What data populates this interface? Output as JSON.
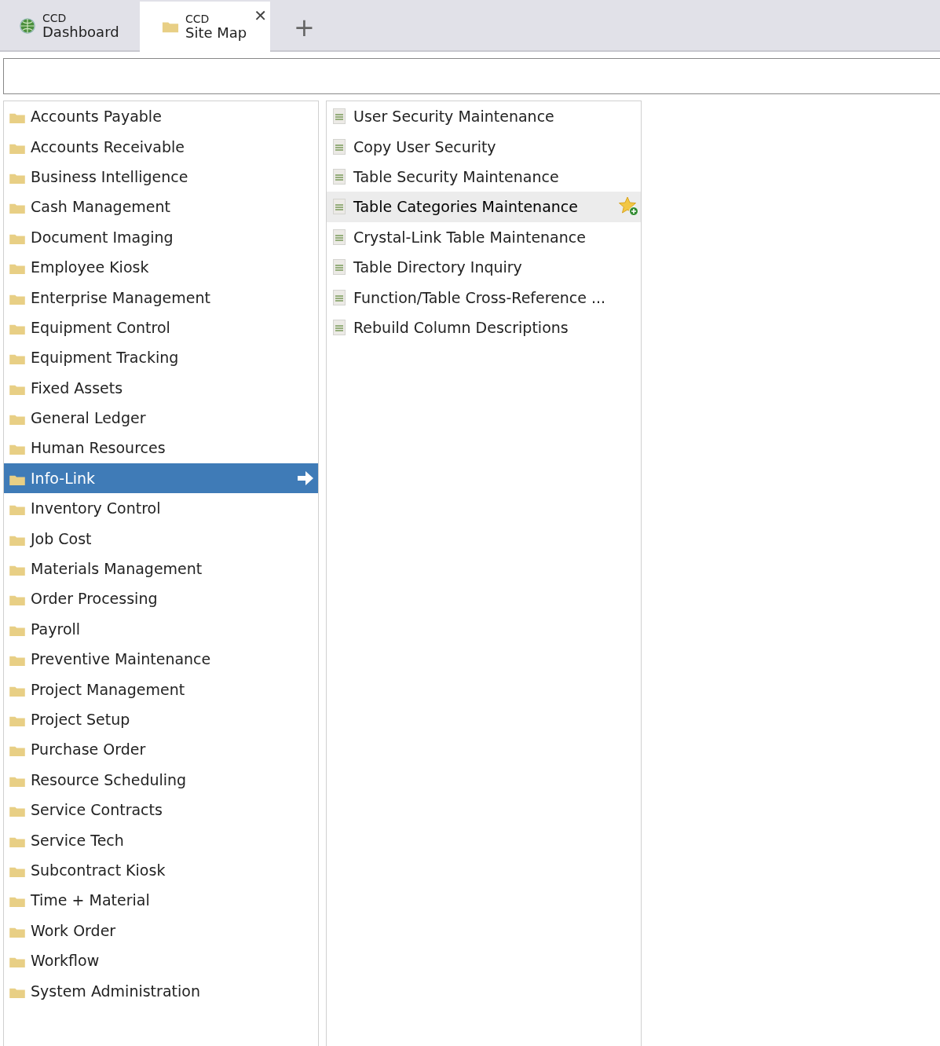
{
  "tabs": [
    {
      "kind": "globe",
      "line1": "CCD",
      "line2": "Dashboard",
      "selected": false,
      "closable": false
    },
    {
      "kind": "folder",
      "line1": "CCD",
      "line2": "Site Map",
      "selected": true,
      "closable": true
    }
  ],
  "new_tab": "+",
  "close_glyph": "✕",
  "modules": [
    {
      "label": "Accounts Payable",
      "selected": false
    },
    {
      "label": "Accounts Receivable",
      "selected": false
    },
    {
      "label": "Business Intelligence",
      "selected": false
    },
    {
      "label": "Cash Management",
      "selected": false
    },
    {
      "label": "Document Imaging",
      "selected": false
    },
    {
      "label": "Employee Kiosk",
      "selected": false
    },
    {
      "label": "Enterprise Management",
      "selected": false
    },
    {
      "label": "Equipment Control",
      "selected": false
    },
    {
      "label": "Equipment Tracking",
      "selected": false
    },
    {
      "label": "Fixed Assets",
      "selected": false
    },
    {
      "label": "General Ledger",
      "selected": false
    },
    {
      "label": "Human Resources",
      "selected": false
    },
    {
      "label": "Info-Link",
      "selected": true
    },
    {
      "label": "Inventory Control",
      "selected": false
    },
    {
      "label": "Job Cost",
      "selected": false
    },
    {
      "label": "Materials Management",
      "selected": false
    },
    {
      "label": "Order Processing",
      "selected": false
    },
    {
      "label": "Payroll",
      "selected": false
    },
    {
      "label": "Preventive Maintenance",
      "selected": false
    },
    {
      "label": "Project Management",
      "selected": false
    },
    {
      "label": "Project Setup",
      "selected": false
    },
    {
      "label": "Purchase Order",
      "selected": false
    },
    {
      "label": "Resource Scheduling",
      "selected": false
    },
    {
      "label": "Service Contracts",
      "selected": false
    },
    {
      "label": "Service Tech",
      "selected": false
    },
    {
      "label": "Subcontract Kiosk",
      "selected": false
    },
    {
      "label": "Time + Material",
      "selected": false
    },
    {
      "label": "Work Order",
      "selected": false
    },
    {
      "label": "Workflow",
      "selected": false
    },
    {
      "label": "System Administration",
      "selected": false
    }
  ],
  "functions": [
    {
      "label": "User Security Maintenance",
      "highlighted": false
    },
    {
      "label": "Copy User Security",
      "highlighted": false
    },
    {
      "label": "Table Security Maintenance",
      "highlighted": false
    },
    {
      "label": "Table Categories Maintenance",
      "highlighted": true
    },
    {
      "label": "Crystal-Link Table Maintenance",
      "highlighted": false
    },
    {
      "label": "Table Directory Inquiry",
      "highlighted": false
    },
    {
      "label": "Function/Table Cross-Reference ...",
      "highlighted": false
    },
    {
      "label": "Rebuild Column Descriptions",
      "highlighted": false
    }
  ]
}
